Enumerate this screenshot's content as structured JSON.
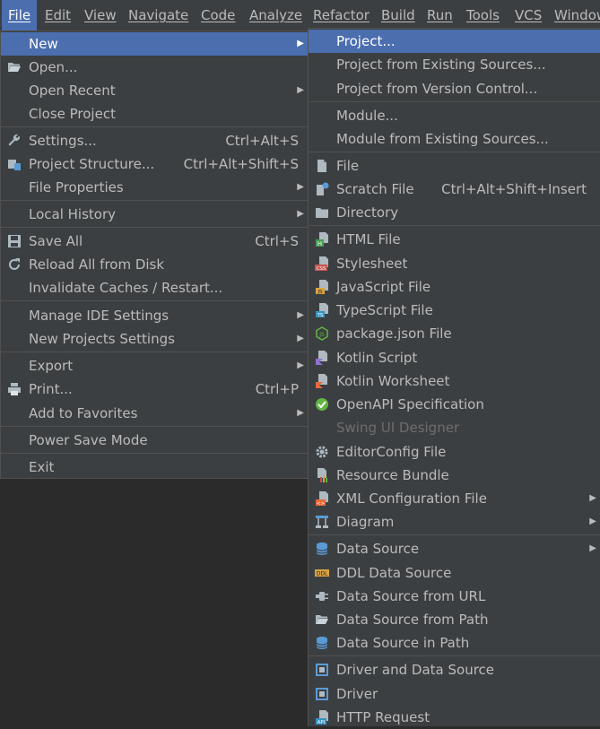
{
  "menubar": {
    "items": [
      "File",
      "Edit",
      "View",
      "Navigate",
      "Code",
      "Analyze",
      "Refactor",
      "Build",
      "Run",
      "Tools",
      "VCS",
      "Window"
    ]
  },
  "file_menu": {
    "new": "New",
    "open": "Open...",
    "open_recent": "Open Recent",
    "close_project": "Close Project",
    "settings": "Settings...",
    "settings_shortcut": "Ctrl+Alt+S",
    "project_structure": "Project Structure...",
    "project_structure_shortcut": "Ctrl+Alt+Shift+S",
    "file_properties": "File Properties",
    "local_history": "Local History",
    "save_all": "Save All",
    "save_all_shortcut": "Ctrl+S",
    "reload": "Reload All from Disk",
    "invalidate": "Invalidate Caches / Restart...",
    "manage_ide": "Manage IDE Settings",
    "new_projects_settings": "New Projects Settings",
    "export": "Export",
    "print": "Print...",
    "print_shortcut": "Ctrl+P",
    "add_favorites": "Add to Favorites",
    "power_save": "Power Save Mode",
    "exit": "Exit"
  },
  "new_menu": {
    "project": "Project...",
    "project_existing": "Project from Existing Sources...",
    "project_vcs": "Project from Version Control...",
    "module": "Module...",
    "module_existing": "Module from Existing Sources...",
    "file": "File",
    "scratch": "Scratch File",
    "scratch_shortcut": "Ctrl+Alt+Shift+Insert",
    "directory": "Directory",
    "html": "HTML File",
    "stylesheet": "Stylesheet",
    "javascript": "JavaScript File",
    "typescript": "TypeScript File",
    "package_json": "package.json File",
    "kotlin_script": "Kotlin Script",
    "kotlin_worksheet": "Kotlin Worksheet",
    "openapi": "OpenAPI Specification",
    "swing": "Swing UI Designer",
    "editorconfig": "EditorConfig File",
    "resource_bundle": "Resource Bundle",
    "xml_config": "XML Configuration File",
    "diagram": "Diagram",
    "data_source": "Data Source",
    "ddl_data_source": "DDL Data Source",
    "ds_url": "Data Source from URL",
    "ds_path": "Data Source from Path",
    "ds_in_path": "Data Source in Path",
    "driver_ds": "Driver and Data Source",
    "driver": "Driver",
    "http_request": "HTTP Request"
  },
  "colors": {
    "menu_bg": "#3c3f41",
    "highlight": "#4b6eaf",
    "text": "#bbbbbb",
    "disabled": "#6d6d6d",
    "separator": "#515151"
  }
}
